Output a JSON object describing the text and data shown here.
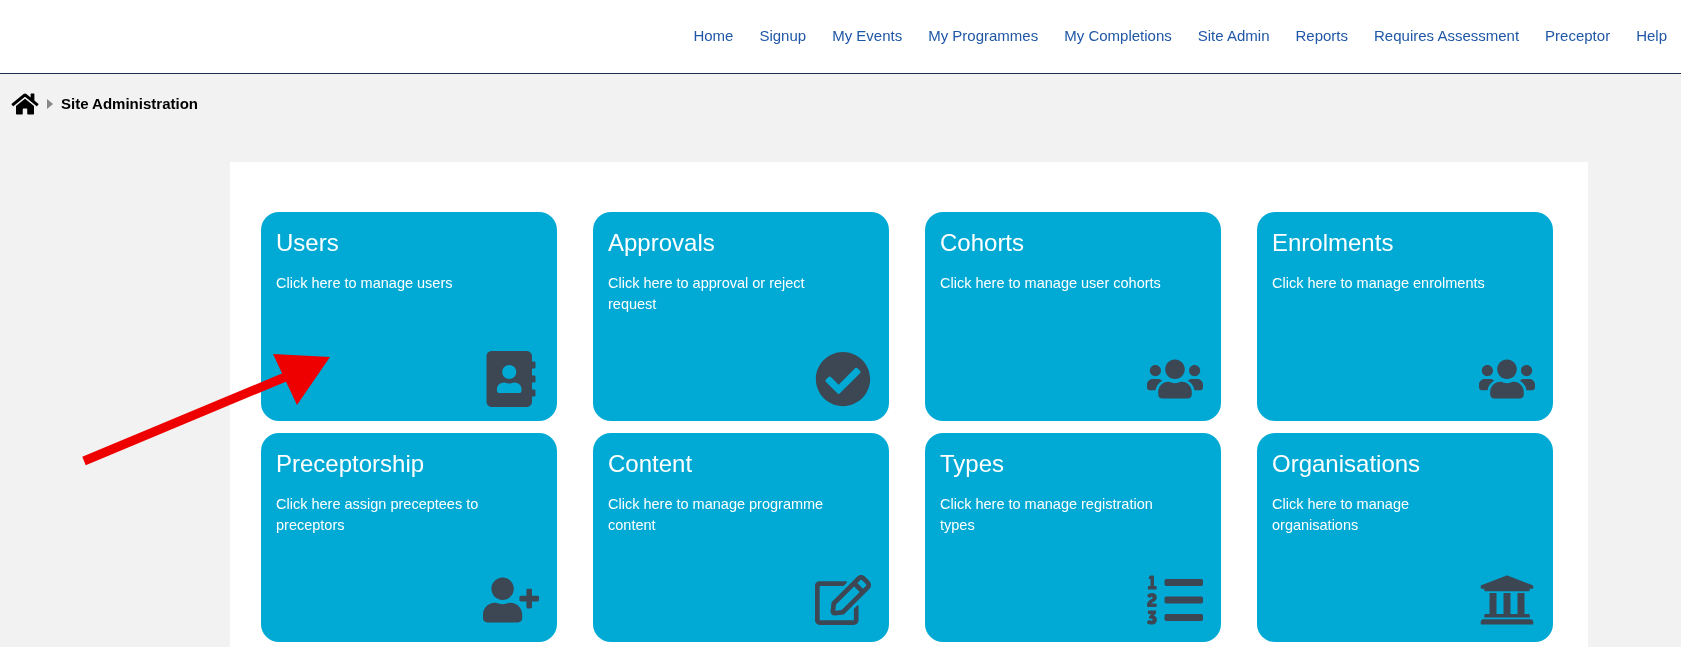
{
  "nav": [
    {
      "label": "Home"
    },
    {
      "label": "Signup"
    },
    {
      "label": "My Events"
    },
    {
      "label": "My Programmes"
    },
    {
      "label": "My Completions"
    },
    {
      "label": "Site Admin"
    },
    {
      "label": "Reports"
    },
    {
      "label": "Requires Assessment"
    },
    {
      "label": "Preceptor"
    },
    {
      "label": "Help"
    }
  ],
  "breadcrumb": {
    "current": "Site Administration"
  },
  "tiles": [
    {
      "title": "Users",
      "description": "Click here to manage users"
    },
    {
      "title": "Approvals",
      "description": "Click here to approval or reject request"
    },
    {
      "title": "Cohorts",
      "description": "Click here to manage user cohorts"
    },
    {
      "title": "Enrolments",
      "description": "Click here to manage enrolments"
    },
    {
      "title": "Preceptorship",
      "description": "Click here assign preceptees to preceptors"
    },
    {
      "title": "Content",
      "description": "Click here to manage programme content"
    },
    {
      "title": "Types",
      "description": "Click here to manage registration types"
    },
    {
      "title": "Organisations",
      "description": "Click here to manage organisations"
    }
  ]
}
